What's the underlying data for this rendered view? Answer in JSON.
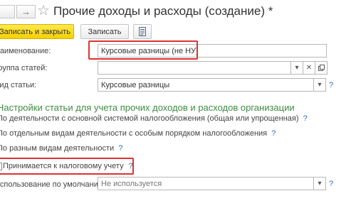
{
  "window": {
    "title": "Прочие доходы и расходы (создание) *"
  },
  "nav": {
    "back_icon": "arrow-left-icon",
    "forward_icon": "arrow-right-icon",
    "forward_glyph": "→",
    "star_glyph": "☆"
  },
  "toolbar": {
    "save_close_label": "Записать и закрыть",
    "save_label": "Записать",
    "extra_icon": "document-list-icon"
  },
  "form": {
    "name": {
      "label": "Наименование:",
      "value": "Курсовые разницы (не НУ)"
    },
    "group": {
      "label": "Группа статей:",
      "value": ""
    },
    "type": {
      "label": "Вид статьи:",
      "value": "Курсовые разницы"
    },
    "help_glyph": "?"
  },
  "section": {
    "title": "Настройки статьи для учета прочих доходов и расходов организации",
    "options": [
      {
        "label": "По деятельности с основной системой налогообложения (общая или упрощенная)",
        "help": "?"
      },
      {
        "label": "По отдельным видам деятельности с особым порядком налогообложения",
        "help": "?"
      },
      {
        "label": "По разным видам деятельности",
        "help": "?"
      }
    ]
  },
  "tax": {
    "label": "Принимается к налоговому учету",
    "help": "?",
    "checked": false
  },
  "default_usage": {
    "label": "Использование по умолчанию:",
    "placeholder": "Не используется"
  },
  "colors": {
    "primary_button": "#f5d000",
    "section_title": "#3d8a41",
    "help_link": "#2a6ebb",
    "highlight": "#e03131"
  }
}
